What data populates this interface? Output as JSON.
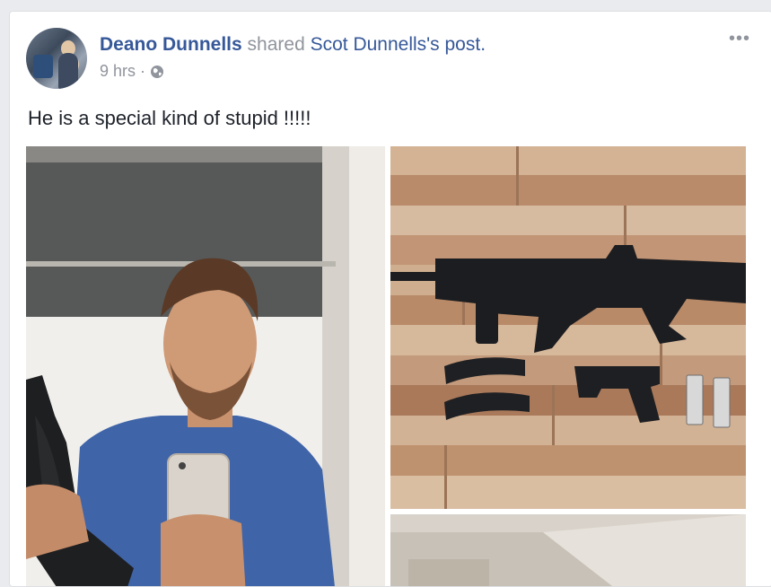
{
  "post": {
    "author": "Deano Dunnells",
    "shared_text": " shared ",
    "original_author_possessive": "Scot Dunnells's",
    "post_word": " post.",
    "timestamp": "9 hrs",
    "separator": "·",
    "audience_icon": "globe-icon",
    "more_icon": "more-options-icon",
    "more_glyph": "•••",
    "text": "He is a special kind of stupid !!!!!"
  },
  "colors": {
    "link": "#365899",
    "meta": "#90949c",
    "text": "#1d2129",
    "background": "#e9ebee"
  },
  "photos": [
    {
      "name": "selfie-photo"
    },
    {
      "name": "firearms-on-wood-photo"
    },
    {
      "name": "third-photo-partial"
    }
  ]
}
